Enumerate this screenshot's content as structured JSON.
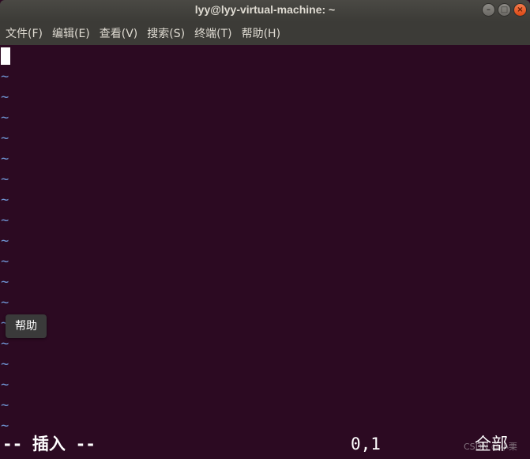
{
  "window": {
    "title": "lyy@lyy-virtual-machine: ~",
    "buttons": [
      "minimize",
      "maximize",
      "close"
    ]
  },
  "menu": [
    {
      "label": "文件(F)"
    },
    {
      "label": "编辑(E)"
    },
    {
      "label": "查看(V)"
    },
    {
      "label": "搜索(S)"
    },
    {
      "label": "终端(T)"
    },
    {
      "label": "帮助(H)"
    }
  ],
  "editor": {
    "empty_line_marker": "~",
    "tooltip": "帮助",
    "mode": "-- 插入 --",
    "position": "0,1",
    "scroll": "全部",
    "watermark": "CSDN @小栗",
    "colors": {
      "background": "#2c0a22",
      "tilde": "#6f95d4",
      "text": "#ffffff"
    }
  }
}
